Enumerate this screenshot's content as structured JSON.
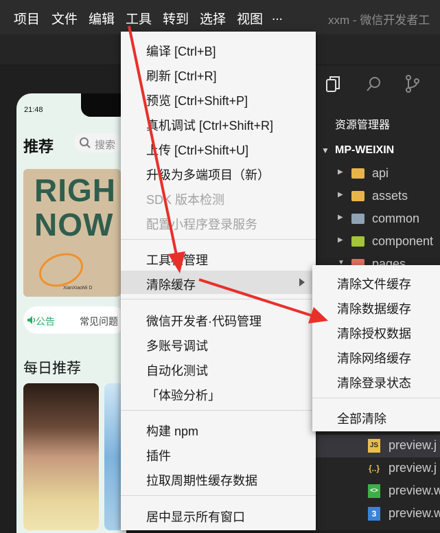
{
  "menubar": {
    "items": [
      "项目",
      "文件",
      "编辑",
      "工具",
      "转到",
      "选择",
      "视图",
      "..."
    ],
    "window_title": "xxm - 微信开发者工"
  },
  "phone": {
    "time": "21:48",
    "title": "推荐",
    "search_placeholder": "搜索",
    "banner_text": "RIGH\nNOW",
    "banner_small": "XianXiaoMi D",
    "notice_tag": "公告",
    "notice_text": "常见问题",
    "section_title": "每日推荐"
  },
  "explorer": {
    "header": "资源管理器",
    "project": "MP-WEIXIN",
    "folders": [
      {
        "label": "api",
        "color": "#e8b44a"
      },
      {
        "label": "assets",
        "color": "#e8b44a"
      },
      {
        "label": "common",
        "color": "#8fa3b5"
      },
      {
        "label": "component",
        "color": "#a4c43a"
      },
      {
        "label": "pages",
        "color": "#e07060"
      }
    ],
    "files": [
      {
        "label": "preview.j",
        "icon": "JS",
        "icon_color": "#e8c04a",
        "selected": true
      },
      {
        "label": "preview.j",
        "icon": "{..}",
        "icon_color": "#e8c04a",
        "selected": false
      },
      {
        "label": "preview.w",
        "icon": "<>",
        "icon_color": "#3fae49",
        "selected": false
      },
      {
        "label": "preview.w",
        "icon": "3",
        "icon_color": "#3b82d6",
        "selected": false
      }
    ]
  },
  "menu": {
    "items": [
      {
        "label": "编译   [Ctrl+B]",
        "disabled": false
      },
      {
        "label": "刷新   [Ctrl+R]",
        "disabled": false
      },
      {
        "label": "预览   [Ctrl+Shift+P]",
        "disabled": false
      },
      {
        "label": "真机调试   [Ctrl+Shift+R]",
        "disabled": false
      },
      {
        "label": "上传   [Ctrl+Shift+U]",
        "disabled": false
      },
      {
        "label": "升级为多端项目（新）",
        "disabled": false
      },
      {
        "label": "SDK 版本检测",
        "disabled": true
      },
      {
        "label": "配置小程序登录服务",
        "disabled": true
      },
      {
        "label": "工具栏管理",
        "disabled": false
      },
      {
        "label": "清除缓存",
        "disabled": false,
        "highlighted": true,
        "has_submenu": true
      },
      {
        "label": "微信开发者·代码管理",
        "disabled": false
      },
      {
        "label": "多账号调试",
        "disabled": false
      },
      {
        "label": "自动化测试",
        "disabled": false
      },
      {
        "label": "「体验分析」",
        "disabled": false
      },
      {
        "label": "构建 npm",
        "disabled": false
      },
      {
        "label": "插件",
        "disabled": false
      },
      {
        "label": "拉取周期性缓存数据",
        "disabled": false
      },
      {
        "label": "居中显示所有窗口",
        "disabled": false
      }
    ]
  },
  "submenu": {
    "items": [
      "清除文件缓存",
      "清除数据缓存",
      "清除授权数据",
      "清除网络缓存",
      "清除登录状态",
      "全部清除"
    ]
  },
  "colors": {
    "annotation_arrow": "#e8302a",
    "menu_bg": "#f5f5f5",
    "highlight": "#e0e0e0"
  }
}
